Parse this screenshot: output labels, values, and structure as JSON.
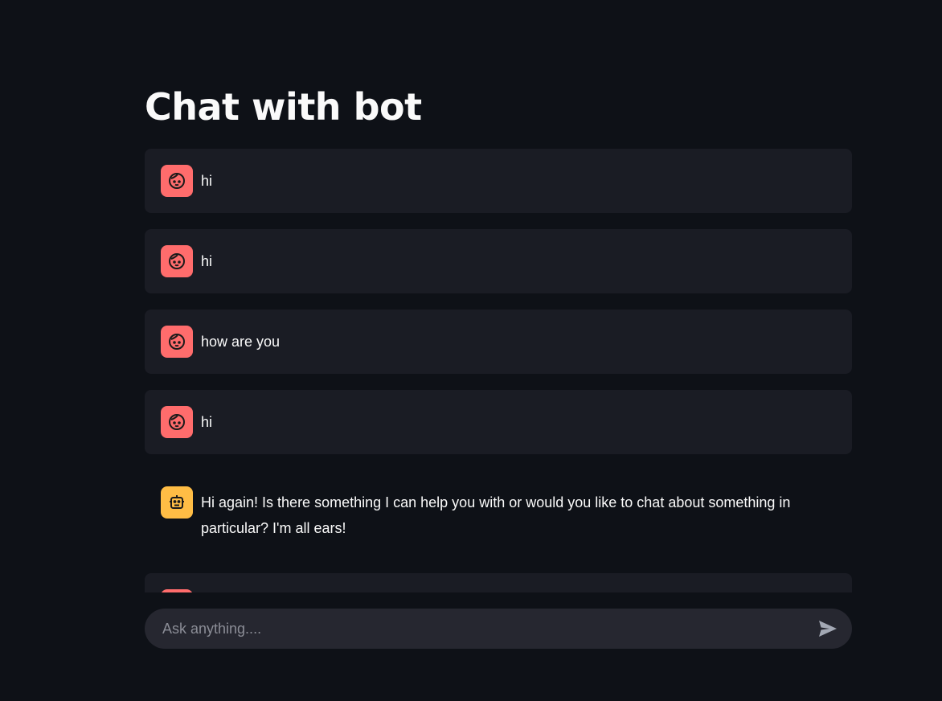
{
  "page": {
    "title": "Chat with bot"
  },
  "messages": [
    {
      "role": "user",
      "text": "hi",
      "avatar_icon": "user-face-icon"
    },
    {
      "role": "user",
      "text": "hi",
      "avatar_icon": "user-face-icon"
    },
    {
      "role": "user",
      "text": "how are you",
      "avatar_icon": "user-face-icon"
    },
    {
      "role": "user",
      "text": "hi",
      "avatar_icon": "user-face-icon"
    },
    {
      "role": "assistant",
      "text": "Hi again! Is there something I can help you with or would you like to chat about something in particular? I'm all ears!",
      "avatar_icon": "robot-icon"
    },
    {
      "role": "user",
      "text": "",
      "avatar_icon": "user-face-icon"
    }
  ],
  "chat_input": {
    "placeholder": "Ask anything....",
    "value": "",
    "send_icon": "send-icon"
  },
  "colors": {
    "background": "#0e1117",
    "user_message_bg": "#1a1c24",
    "user_avatar": "#ff6c6c",
    "bot_avatar": "#ffbd45",
    "input_bg": "#262730",
    "text": "#fafafa"
  }
}
